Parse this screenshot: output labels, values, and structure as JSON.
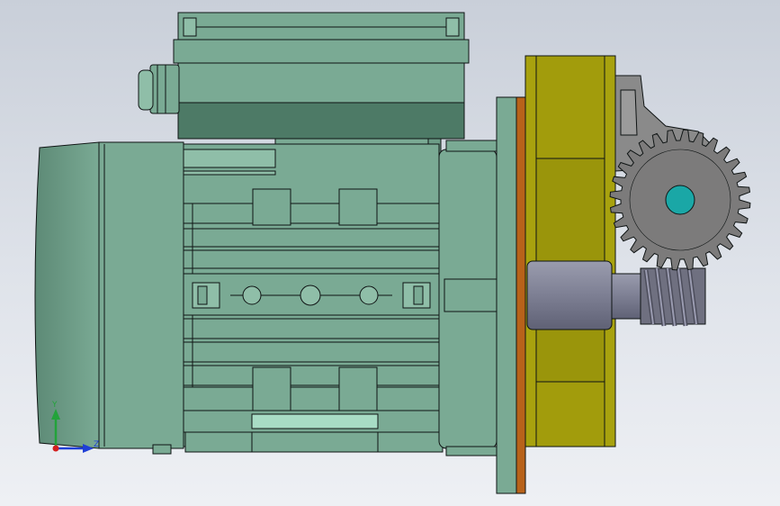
{
  "viewport": {
    "view_name": "Right view",
    "background_top": "#c9cfd9",
    "background_bottom": "#eef0f4"
  },
  "model": {
    "parts": [
      "motor-housing",
      "terminal-box",
      "cable-gland",
      "motor-cooling-fins",
      "motor-foot",
      "motor-flange",
      "flange-gasket",
      "gearbox-housing",
      "output-shaft",
      "worm-screw",
      "worm-gear",
      "gear-bracket"
    ],
    "colors": {
      "motor_green": "#7aaa94",
      "motor_green_dark": "#4d7a66",
      "motor_green_light": "#9ccbb5",
      "gasket_orange": "#b8621a",
      "gearbox_yellow": "#a8a20e",
      "gearbox_yellow_dark": "#8b8709",
      "shaft_steel": "#7d7f93",
      "gear_gray": "#7c7b7b",
      "gear_hub_cyan": "#1aa7a6",
      "outline": "#0f1414"
    }
  },
  "triad": {
    "x_label": "Y",
    "z_label": "Z",
    "y_color": "#22a33a",
    "z_color": "#1f3fd6",
    "x_color": "#d42020"
  }
}
